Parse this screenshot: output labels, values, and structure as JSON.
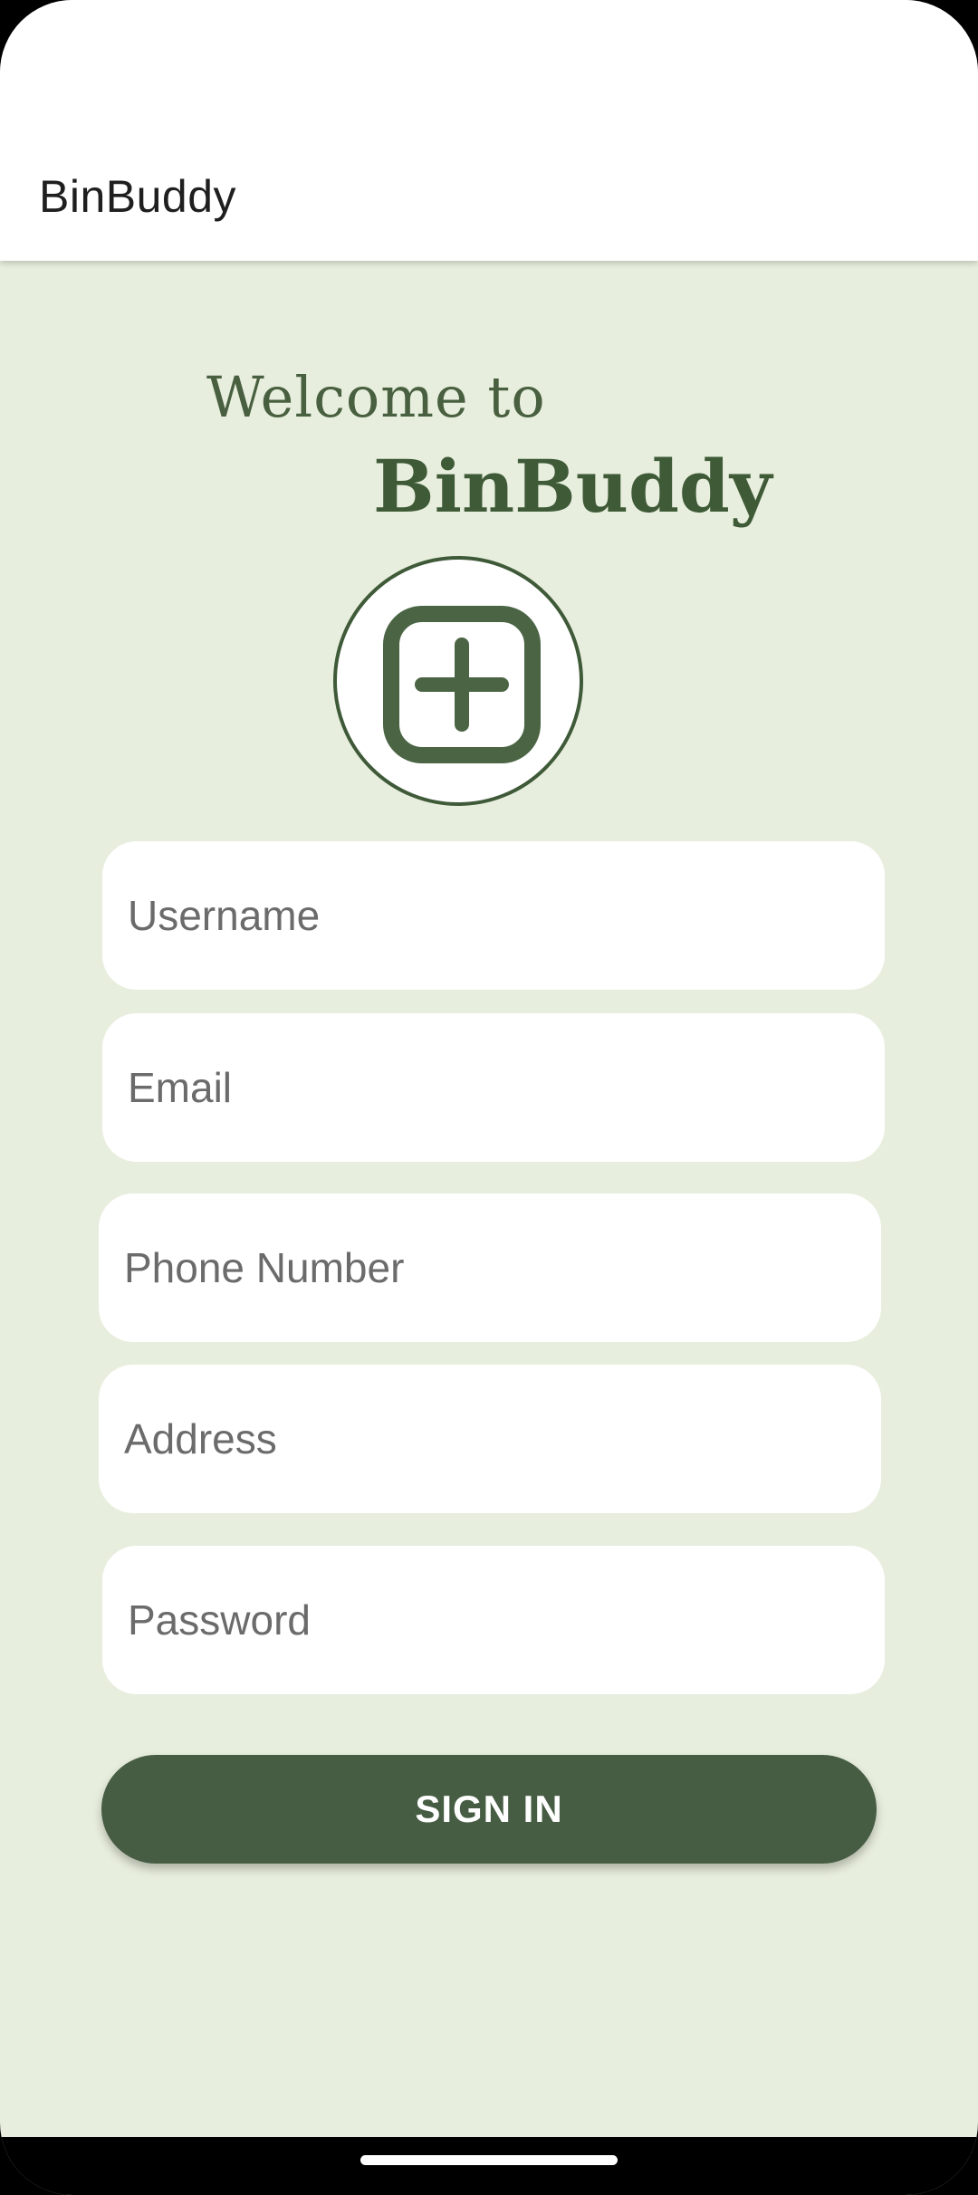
{
  "app_bar": {
    "title": "BinBuddy"
  },
  "hero": {
    "welcome": "Welcome to",
    "brand": "BinBuddy",
    "logo_icon": "plus-square-icon"
  },
  "form": {
    "username_placeholder": "Username",
    "email_placeholder": "Email",
    "phone_placeholder": "Phone Number",
    "address_placeholder": "Address",
    "password_placeholder": "Password",
    "sign_in_label": "SIGN IN"
  },
  "colors": {
    "background": "#e8eedd",
    "accent": "#465d43",
    "app_bar": "#ffffff"
  }
}
